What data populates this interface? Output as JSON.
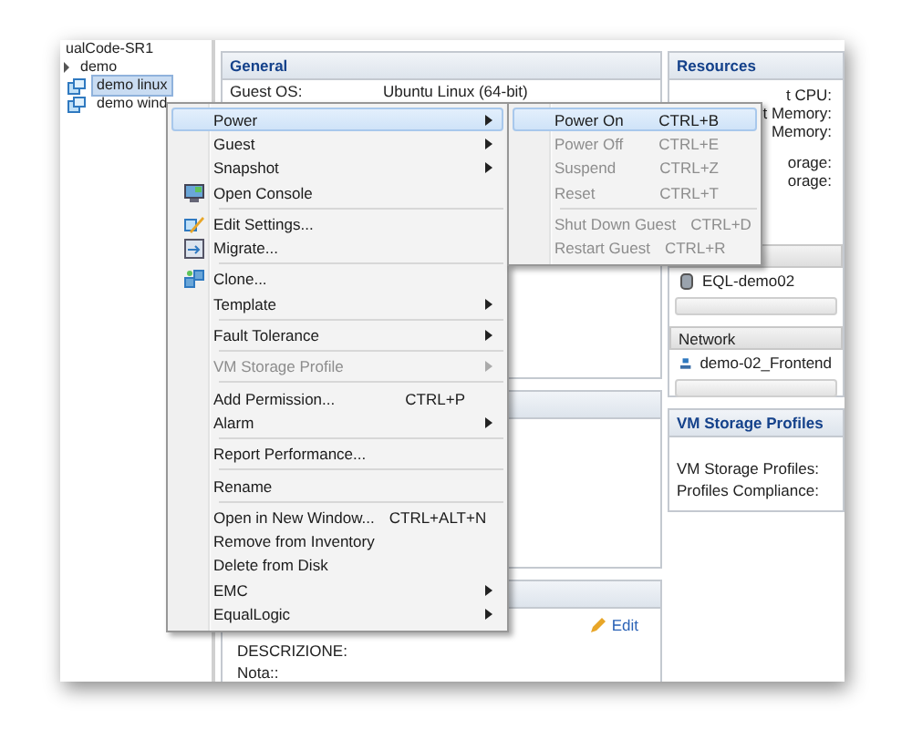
{
  "tree": {
    "items": [
      {
        "label": "ualCode-SR1",
        "kind": "host",
        "selected": false
      },
      {
        "label": "demo",
        "kind": "folder",
        "selected": false
      },
      {
        "label": "demo linux",
        "kind": "vm",
        "selected": true
      },
      {
        "label": "demo wind",
        "kind": "vm",
        "selected": false
      }
    ]
  },
  "general": {
    "title": "General",
    "rows": [
      {
        "label": "Guest OS:",
        "value": "Ubuntu Linux (64-bit)"
      }
    ]
  },
  "annotations": {
    "edit_link": "Edit",
    "fields": [
      "DESCRIZIONE:",
      "Nota::"
    ]
  },
  "resources": {
    "title": "Resources",
    "lines": [
      "t CPU:",
      "t Memory:",
      "Memory:",
      "orage:",
      "orage:"
    ],
    "storage": {
      "rows": [
        "EQL-demo02"
      ]
    },
    "network": {
      "title": "Network",
      "rows": [
        "demo-02_Frontend"
      ]
    }
  },
  "storage_profiles": {
    "title": "VM Storage Profiles",
    "lines": [
      "VM Storage Profiles:",
      "Profiles Compliance:"
    ]
  },
  "context_menu": {
    "groups": [
      [
        {
          "label": "Power",
          "kind": "submenu",
          "selected": true,
          "disabled": false
        },
        {
          "label": "Guest",
          "kind": "submenu",
          "selected": false,
          "disabled": false
        },
        {
          "label": "Snapshot",
          "kind": "submenu",
          "selected": false,
          "disabled": false
        },
        {
          "label": "Open Console",
          "kind": "console",
          "selected": false,
          "disabled": false
        }
      ],
      [
        {
          "label": "Edit Settings...",
          "kind": "edit",
          "selected": false,
          "disabled": false
        },
        {
          "label": "Migrate...",
          "kind": "migrate",
          "selected": false,
          "disabled": false
        }
      ],
      [
        {
          "label": "Clone...",
          "kind": "clone",
          "selected": false,
          "disabled": false
        },
        {
          "label": "Template",
          "kind": "submenu",
          "selected": false,
          "disabled": false
        }
      ],
      [
        {
          "label": "Fault Tolerance",
          "kind": "submenu",
          "selected": false,
          "disabled": false
        }
      ],
      [
        {
          "label": "VM Storage Profile",
          "kind": "submenu",
          "selected": false,
          "disabled": true
        }
      ],
      [
        {
          "label": "Add Permission...",
          "shortcut": "CTRL+P",
          "kind": "command",
          "selected": false,
          "disabled": false
        },
        {
          "label": "Alarm",
          "kind": "submenu",
          "selected": false,
          "disabled": false
        }
      ],
      [
        {
          "label": "Report Performance...",
          "kind": "command",
          "selected": false,
          "disabled": false
        }
      ],
      [
        {
          "label": "Rename",
          "kind": "command",
          "selected": false,
          "disabled": false
        }
      ],
      [
        {
          "label": "Open in New Window...",
          "shortcut": "CTRL+ALT+N",
          "kind": "command",
          "selected": false,
          "disabled": false
        },
        {
          "label": "Remove from Inventory",
          "kind": "command",
          "selected": false,
          "disabled": false
        },
        {
          "label": "Delete from Disk",
          "kind": "command",
          "selected": false,
          "disabled": false
        },
        {
          "label": "EMC",
          "kind": "submenu",
          "selected": false,
          "disabled": false
        },
        {
          "label": "EqualLogic",
          "kind": "submenu",
          "selected": false,
          "disabled": false
        }
      ]
    ]
  },
  "power_submenu": {
    "groups": [
      [
        {
          "label": "Power On",
          "shortcut": "CTRL+B",
          "selected": true,
          "disabled": false
        },
        {
          "label": "Power Off",
          "shortcut": "CTRL+E",
          "selected": false,
          "disabled": true
        },
        {
          "label": "Suspend",
          "shortcut": "CTRL+Z",
          "selected": false,
          "disabled": true
        },
        {
          "label": "Reset",
          "shortcut": "CTRL+T",
          "selected": false,
          "disabled": true
        }
      ],
      [
        {
          "label": "Shut Down Guest",
          "shortcut": "CTRL+D",
          "selected": false,
          "disabled": true
        },
        {
          "label": "Restart Guest",
          "shortcut": "CTRL+R",
          "selected": false,
          "disabled": true
        }
      ]
    ]
  }
}
